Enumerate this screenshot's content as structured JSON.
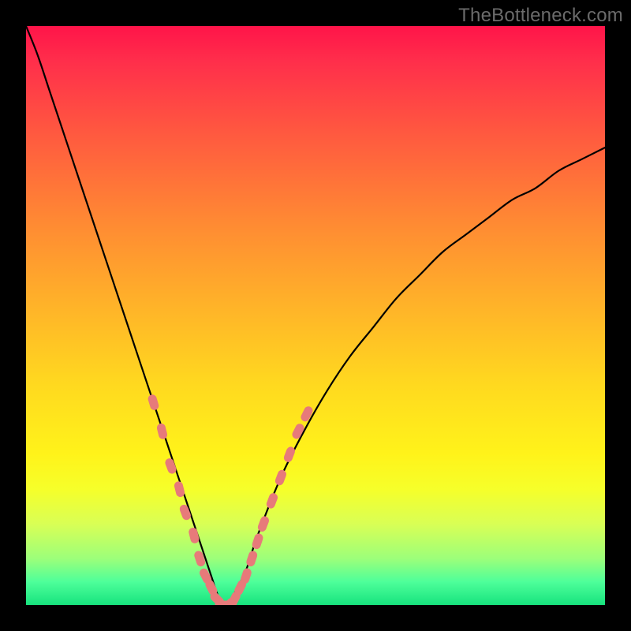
{
  "watermark": "TheBottleneck.com",
  "colors": {
    "frame": "#000000",
    "gradient_top": "#ff1449",
    "gradient_mid": "#ffd91f",
    "gradient_bottom": "#17e37e",
    "curve": "#000000",
    "marker": "#e77a7a"
  },
  "chart_data": {
    "type": "line",
    "title": "",
    "xlabel": "",
    "ylabel": "",
    "xlim": [
      0,
      100
    ],
    "ylim": [
      0,
      100
    ],
    "grid": false,
    "x": [
      0,
      2,
      4,
      6,
      8,
      10,
      12,
      14,
      16,
      18,
      20,
      22,
      24,
      26,
      28,
      30,
      32,
      33,
      34,
      35,
      36,
      38,
      40,
      44,
      48,
      52,
      56,
      60,
      64,
      68,
      72,
      76,
      80,
      84,
      88,
      92,
      96,
      100
    ],
    "series": [
      {
        "name": "bottleneck-curve",
        "values": [
          100,
          95,
          89,
          83,
          77,
          71,
          65,
          59,
          53,
          47,
          41,
          35,
          29,
          23,
          17,
          11,
          5,
          2,
          0,
          0,
          2,
          6,
          12,
          22,
          30,
          37,
          43,
          48,
          53,
          57,
          61,
          64,
          67,
          70,
          72,
          75,
          77,
          79
        ]
      }
    ],
    "markers": {
      "name": "highlighted-points",
      "points": [
        {
          "x": 22,
          "y": 35
        },
        {
          "x": 23.5,
          "y": 30
        },
        {
          "x": 25,
          "y": 24
        },
        {
          "x": 26.5,
          "y": 20
        },
        {
          "x": 27.5,
          "y": 16
        },
        {
          "x": 29,
          "y": 12
        },
        {
          "x": 30,
          "y": 8
        },
        {
          "x": 31,
          "y": 5
        },
        {
          "x": 32,
          "y": 3
        },
        {
          "x": 33,
          "y": 1
        },
        {
          "x": 34,
          "y": 0
        },
        {
          "x": 35,
          "y": 0
        },
        {
          "x": 36,
          "y": 1
        },
        {
          "x": 37,
          "y": 3
        },
        {
          "x": 38,
          "y": 5
        },
        {
          "x": 39,
          "y": 8
        },
        {
          "x": 40,
          "y": 11
        },
        {
          "x": 41,
          "y": 14
        },
        {
          "x": 42.5,
          "y": 18
        },
        {
          "x": 44,
          "y": 22
        },
        {
          "x": 45.5,
          "y": 26
        },
        {
          "x": 47,
          "y": 30
        },
        {
          "x": 48.5,
          "y": 33
        }
      ]
    },
    "annotations": []
  }
}
